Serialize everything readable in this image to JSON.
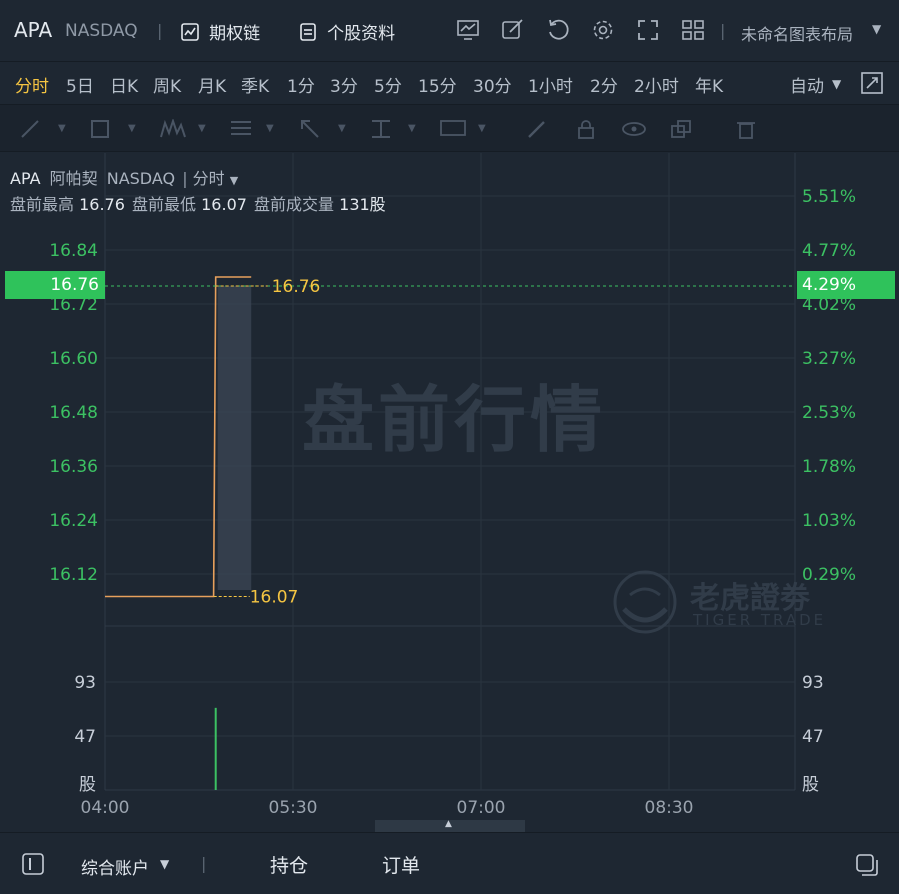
{
  "header": {
    "symbol": "APA",
    "exchange": "NASDAQ",
    "sep": "|",
    "options_chain": "期权链",
    "profile": "个股资料",
    "layout_name": "未命名图表布局"
  },
  "periods": {
    "items": [
      "分时",
      "5日",
      "日K",
      "周K",
      "月K",
      "季K",
      "1分",
      "3分",
      "5分",
      "15分",
      "30分",
      "1小时",
      "2分",
      "2小时",
      "年K"
    ],
    "active": "分时",
    "mode": "自动"
  },
  "chart_info": {
    "symbol": "APA",
    "name": "阿帕契",
    "exchange": "NASDAQ",
    "period": "分时",
    "high_label": "盘前最高",
    "high": "16.76",
    "low_label": "盘前最低",
    "low": "16.07",
    "volume_label": "盘前成交量",
    "volume": "131股",
    "watermark": "盘前行情",
    "brand_cn": "老虎證劵",
    "brand_en": "TIGER TRADE"
  },
  "chart_data": {
    "type": "line",
    "x_ticks": [
      "04:00",
      "05:30",
      "07:00",
      "08:30"
    ],
    "y_left_ticks": [
      16.84,
      16.72,
      16.6,
      16.48,
      16.36,
      16.24,
      16.12
    ],
    "y_right_ticks": [
      "5.51%",
      "4.77%",
      "4.02%",
      "3.27%",
      "2.53%",
      "1.78%",
      "1.03%",
      "0.29%"
    ],
    "current_price": "16.76",
    "current_pct": "4.29%",
    "high_marker": "16.76",
    "low_marker": "16.07",
    "price_series": [
      {
        "time": "04:00",
        "price": 16.07
      },
      {
        "time": "04:52",
        "price": 16.07
      },
      {
        "time": "04:53",
        "price": 16.78
      },
      {
        "time": "05:10",
        "price": 16.78
      }
    ],
    "volume_ticks_left": [
      "93",
      "47",
      "股"
    ],
    "volume_ticks_right": [
      "93",
      "47",
      "股"
    ],
    "volume_bars": [
      {
        "time": "04:53",
        "volume": 131
      }
    ],
    "colors": {
      "up": "#3cc163",
      "line": "#e7a05c",
      "marker": "#f5c542"
    }
  },
  "footer": {
    "account": "综合账户",
    "positions": "持仓",
    "orders": "订单"
  }
}
